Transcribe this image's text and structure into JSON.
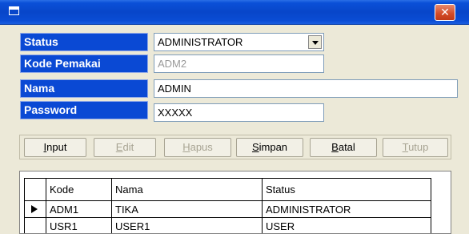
{
  "window": {
    "close_glyph": "✕"
  },
  "form": {
    "status": {
      "label": "Status",
      "value": "ADMINISTRATOR"
    },
    "kode": {
      "label": "Kode Pemakai",
      "value": "ADM2"
    },
    "nama": {
      "label": "Nama",
      "value": "ADMIN"
    },
    "password": {
      "label": "Password",
      "value": "XXXXX"
    }
  },
  "buttons": {
    "input": {
      "label": "Input",
      "enabled": true
    },
    "edit": {
      "label": "Edit",
      "enabled": false
    },
    "hapus": {
      "label": "Hapus",
      "enabled": false
    },
    "simpan": {
      "label": "Simpan",
      "enabled": true
    },
    "batal": {
      "label": "Batal",
      "enabled": true
    },
    "tutup": {
      "label": "Tutup",
      "enabled": false
    }
  },
  "grid": {
    "columns": [
      "Kode",
      "Nama",
      "Status"
    ],
    "rows": [
      {
        "kode": "ADM1",
        "nama": "TIKA",
        "status": "ADMINISTRATOR",
        "current": true
      },
      {
        "kode": "USR1",
        "nama": "USER1",
        "status": "USER",
        "current": false
      }
    ]
  },
  "colors": {
    "titlebar": "#0846c9",
    "label_bg": "#0a49d4",
    "close": "#d24a26"
  }
}
